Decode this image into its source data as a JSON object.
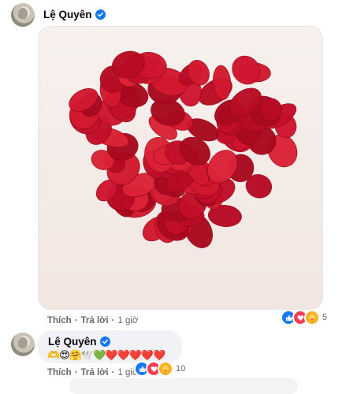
{
  "post": {
    "author": "Lệ Quyên",
    "verified_icon": "verified-badge-icon",
    "image_icon": "heart-of-rose-petals-image",
    "actions": {
      "like": "Thích",
      "separator": "·",
      "reply": "Trả lời",
      "time": "1 giờ"
    },
    "reactions": {
      "icons": [
        "like-icon",
        "love-icon",
        "care-icon"
      ],
      "count": "5"
    }
  },
  "reply": {
    "author": "Lệ Quyên",
    "verified_icon": "verified-badge-icon",
    "emojis": "🫶😍🤗🕊️💚❤️❤️❤️❤️❤️",
    "actions": {
      "like": "Thích",
      "separator": "·",
      "reply": "Trả lời",
      "time": "1 giờ"
    },
    "reactions": {
      "icons": [
        "like-icon",
        "love-icon",
        "care-icon"
      ],
      "count": "10"
    }
  },
  "colors": {
    "verified": "#1877f2",
    "meta_text": "#65676b",
    "bubble_bg": "#f0f2f5",
    "petal_red": "#c8102e"
  }
}
